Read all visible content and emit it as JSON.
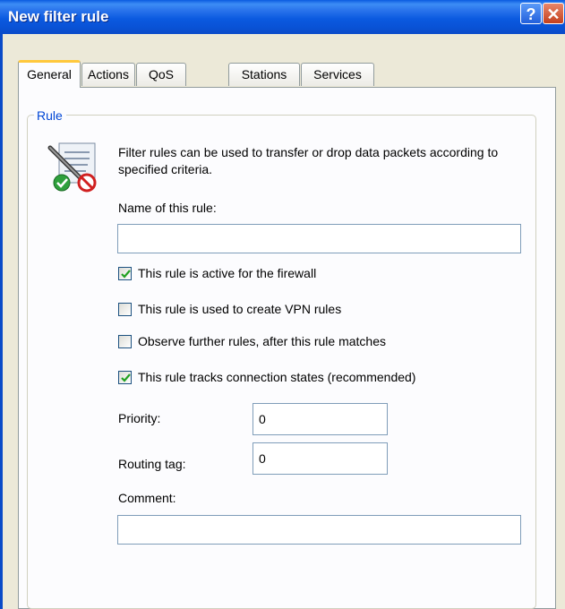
{
  "window": {
    "title": "New filter rule"
  },
  "titlebar_buttons": {
    "help": "?",
    "close": "✕"
  },
  "tabs": [
    {
      "label": "General",
      "active": true
    },
    {
      "label": "Actions",
      "active": false
    },
    {
      "label": "QoS",
      "active": false
    },
    {
      "label": "Stations",
      "active": false
    },
    {
      "label": "Services",
      "active": false
    }
  ],
  "group": {
    "label": "Rule",
    "description": "Filter rules can be used to transfer or drop data packets according to specified criteria."
  },
  "fields": {
    "name": {
      "label": "Name of this rule:",
      "value": ""
    },
    "priority": {
      "label": "Priority:",
      "value": "0"
    },
    "routing_tag": {
      "label": "Routing tag:",
      "value": "0"
    },
    "comment": {
      "label": "Comment:",
      "value": ""
    }
  },
  "checkboxes": [
    {
      "label": "This rule is active for the firewall",
      "checked": true
    },
    {
      "label": "This rule is used to create VPN rules",
      "checked": false
    },
    {
      "label": "Observe further rules, after this rule matches",
      "checked": false
    },
    {
      "label": "This rule tracks connection states (recommended)",
      "checked": true
    }
  ],
  "icons": {
    "illustration": "rule-document-icon"
  },
  "colors": {
    "titlebar": "#0a5be0",
    "group_label": "#0046d5",
    "tab_highlight": "#ffc83c",
    "check": "#21a121"
  }
}
